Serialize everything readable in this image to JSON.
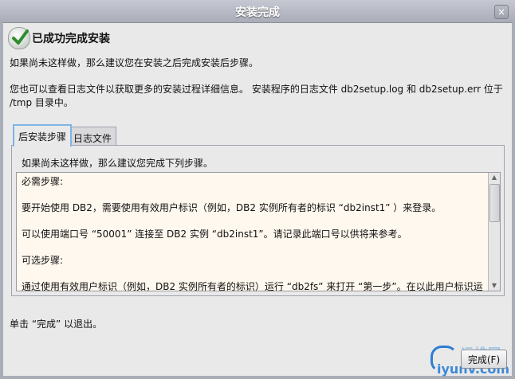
{
  "window": {
    "title": "安装完成",
    "close_glyph": "×"
  },
  "header": {
    "title": "已成功完成安装"
  },
  "body": {
    "line1": "如果尚未这样做，那么建议您在安装之后完成安装后步骤。",
    "line2": "您也可以查看日志文件以获取更多的安装过程详细信息。 安装程序的日志文件 db2setup.log 和 db2setup.err 位于 /tmp 目录中。"
  },
  "tabs": [
    {
      "label": "后安装步骤"
    },
    {
      "label": "日志文件"
    }
  ],
  "panel": {
    "description": "如果尚未这样做，那么建议您完成下列步骤。",
    "paragraphs": [
      "必需步骤:",
      "要开始使用 DB2，需要使用有效用户标识（例如，DB2 实例所有者的标识 “db2inst1” ）来登录。",
      "可以使用端口号 “50001” 连接至 DB2 实例 “db2inst1”。请记录此端口号以供将来参考。",
      "可选步骤:",
      "通过使用有效用户标识（例如，DB2 实例所有者的标识）运行 “db2fs” 来打开 “第一步”。在以此用户标识运行时，您将需要设置 DISPLAY 并且启动可至此的 X 显示服务器。"
    ]
  },
  "footer": {
    "text": "单击 “完成” 以退出。",
    "finish_label": "完成(F)"
  },
  "watermark": {
    "line1": "运维网",
    "line2": "iyunv.com"
  },
  "colors": {
    "titlebar": "#b5b9c3",
    "accent_tab": "#7fb4e6",
    "textbox_bg": "#fff8ee",
    "check": "#2e8b2e"
  },
  "icons": {
    "header_icon": "check-icon"
  }
}
